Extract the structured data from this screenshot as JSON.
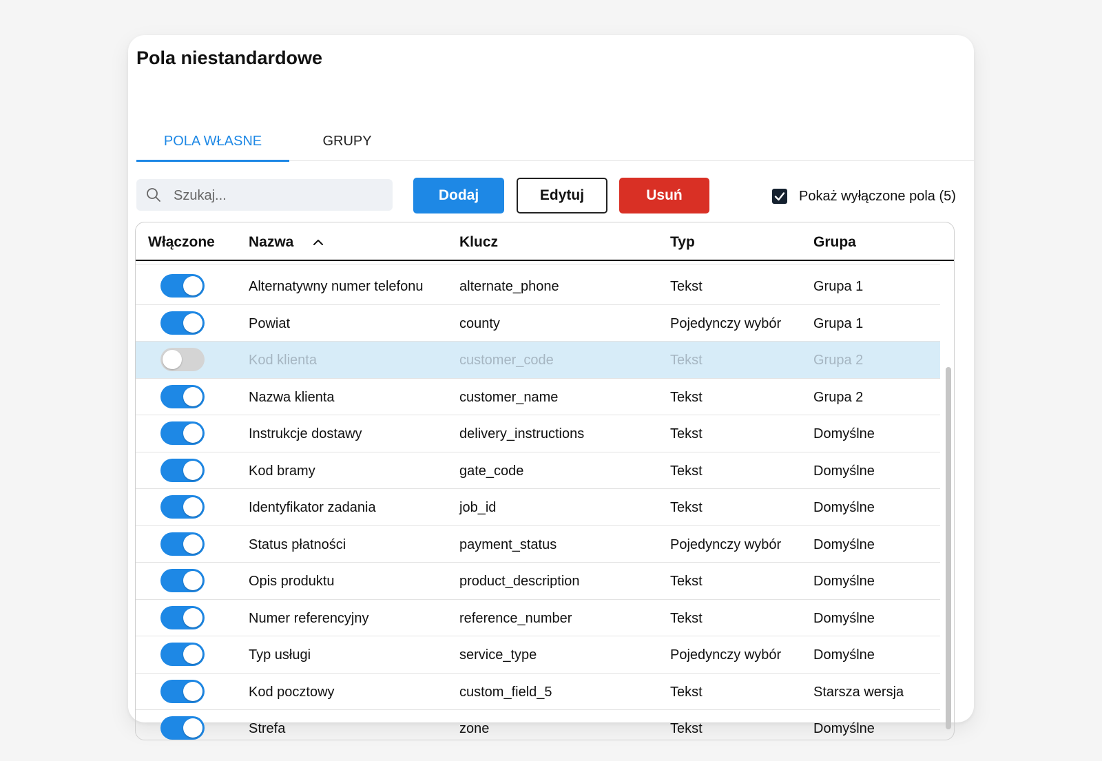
{
  "dialog": {
    "title": "Pola niestandardowe"
  },
  "tabs": [
    {
      "label": "POLA WŁASNE",
      "active": true
    },
    {
      "label": "GRUPY",
      "active": false
    }
  ],
  "search": {
    "placeholder": "Szukaj...",
    "icon": "search-icon"
  },
  "toolbar": {
    "add_label": "Dodaj",
    "edit_label": "Edytuj",
    "delete_label": "Usuń",
    "show_disabled_label": "Pokaż wyłączone pola (5)",
    "show_disabled_checked": true
  },
  "colors": {
    "accent": "#1e88e5",
    "danger": "#d93025",
    "selected_row": "#d7ecf8",
    "switch_off": "#d4d4d4"
  },
  "table": {
    "columns": {
      "enabled": "Włączone",
      "name": "Nazwa",
      "key": "Klucz",
      "type": "Typ",
      "group": "Grupa"
    },
    "sort": {
      "column": "name",
      "direction": "ascending",
      "icon": "chevron-up-icon"
    },
    "rows": [
      {
        "enabled": true,
        "name": "Alternatywny numer telefonu",
        "key": "alternate_phone",
        "type": "Tekst",
        "group": "Grupa 1",
        "selected": false
      },
      {
        "enabled": true,
        "name": "Powiat",
        "key": "county",
        "type": "Pojedynczy wybór",
        "group": "Grupa 1",
        "selected": false
      },
      {
        "enabled": false,
        "name": "Kod klienta",
        "key": "customer_code",
        "type": "Tekst",
        "group": "Grupa 2",
        "selected": true
      },
      {
        "enabled": true,
        "name": "Nazwa klienta",
        "key": "customer_name",
        "type": "Tekst",
        "group": "Grupa 2",
        "selected": false
      },
      {
        "enabled": true,
        "name": "Instrukcje dostawy",
        "key": "delivery_instructions",
        "type": "Tekst",
        "group": "Domyślne",
        "selected": false
      },
      {
        "enabled": true,
        "name": "Kod bramy",
        "key": "gate_code",
        "type": "Tekst",
        "group": "Domyślne",
        "selected": false
      },
      {
        "enabled": true,
        "name": "Identyfikator zadania",
        "key": "job_id",
        "type": "Tekst",
        "group": "Domyślne",
        "selected": false
      },
      {
        "enabled": true,
        "name": "Status płatności",
        "key": "payment_status",
        "type": "Pojedynczy wybór",
        "group": "Domyślne",
        "selected": false
      },
      {
        "enabled": true,
        "name": "Opis produktu",
        "key": "product_description",
        "type": "Tekst",
        "group": "Domyślne",
        "selected": false
      },
      {
        "enabled": true,
        "name": "Numer referencyjny",
        "key": "reference_number",
        "type": "Tekst",
        "group": "Domyślne",
        "selected": false
      },
      {
        "enabled": true,
        "name": "Typ usługi",
        "key": "service_type",
        "type": "Pojedynczy wybór",
        "group": "Domyślne",
        "selected": false
      },
      {
        "enabled": true,
        "name": "Kod pocztowy",
        "key": "custom_field_5",
        "type": "Tekst",
        "group": "Starsza wersja",
        "selected": false
      },
      {
        "enabled": true,
        "name": "Strefa",
        "key": "zone",
        "type": "Tekst",
        "group": "Domyślne",
        "selected": false
      }
    ]
  }
}
